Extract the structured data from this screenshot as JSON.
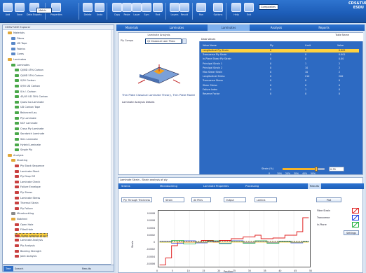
{
  "app": {
    "logo_line1": "CDS&TUDE",
    "logo_line2": "ESDU"
  },
  "toolbar": {
    "items": [
      {
        "label": "Add",
        "icon": "add-document-icon"
      },
      {
        "label": "Save",
        "icon": "save-icon"
      },
      {
        "label": "Data Exports",
        "icon": "export-icon"
      },
      {
        "label": "Properties",
        "icon": "properties-icon"
      },
      {
        "label": "Delete",
        "icon": "delete-icon"
      },
      {
        "label": "Undo",
        "icon": "undo-icon"
      },
      {
        "label": "Copy",
        "icon": "copy-icon"
      },
      {
        "label": "Paste",
        "icon": "paste-icon"
      },
      {
        "label": "Layer",
        "icon": "layer-icon"
      },
      {
        "label": "Sym",
        "icon": "symmetry-icon"
      },
      {
        "label": "Find",
        "icon": "find-icon"
      },
      {
        "label": "Layers",
        "icon": "layers-icon"
      },
      {
        "label": "Result",
        "icon": "result-icon"
      },
      {
        "label": "Run",
        "icon": "run-icon"
      },
      {
        "label": "Options",
        "icon": "options-icon"
      },
      {
        "label": "Help",
        "icon": "help-icon"
      },
      {
        "label": "Exit",
        "icon": "exit-icon"
      }
    ],
    "unit_combo": "Metric",
    "layers_combo": "Composites",
    "composite_label": "Composites"
  },
  "tree": {
    "header": "CDS&TUDE Explorer",
    "rows": [
      {
        "text": "Materials",
        "icon": "fold",
        "indent": 1
      },
      {
        "text": "Fibres",
        "icon": "doc",
        "indent": 2
      },
      {
        "text": "UD Tape",
        "icon": "doc",
        "indent": 2
      },
      {
        "text": "Fabrics",
        "icon": "doc",
        "indent": 2
      },
      {
        "text": "Cores",
        "icon": "doc",
        "indent": 2
      },
      {
        "text": "Laminates",
        "icon": "fold",
        "indent": 1
      },
      {
        "text": "Laminates",
        "icon": "grn",
        "indent": 2
      },
      {
        "text": "QI/ND 45% Carbon",
        "icon": "grn",
        "indent": 3
      },
      {
        "text": "QI/ND 55% Carbon",
        "icon": "grn",
        "indent": 3
      },
      {
        "text": "0/90 Carbon",
        "icon": "grn",
        "indent": 3
      },
      {
        "text": "0/90 UD Carbon",
        "icon": "grn",
        "indent": 3
      },
      {
        "text": "0/+/- Carbon",
        "icon": "grn",
        "indent": 3
      },
      {
        "text": "45/45 UD 30% Carbon",
        "icon": "grn",
        "indent": 3
      },
      {
        "text": "Quasi Iso Laminate",
        "icon": "grn",
        "indent": 3
      },
      {
        "text": "UD Carbon Tape",
        "icon": "grn",
        "indent": 3
      },
      {
        "text": "Balanced Lay",
        "icon": "grn",
        "indent": 3
      },
      {
        "text": "Ply Laminate",
        "icon": "grn",
        "indent": 3
      },
      {
        "text": "NCF Laminate",
        "icon": "grn",
        "indent": 3
      },
      {
        "text": "Cross Ply Laminate",
        "icon": "grn",
        "indent": 3
      },
      {
        "text": "Sandwich Laminate",
        "icon": "grn",
        "indent": 3
      },
      {
        "text": "Skin Laminate",
        "icon": "grn",
        "indent": 3
      },
      {
        "text": "Hybrid Laminate",
        "icon": "grn",
        "indent": 3
      },
      {
        "text": "Single Ply",
        "icon": "grn",
        "indent": 3
      },
      {
        "text": "Analysis",
        "icon": "fold",
        "indent": 1
      },
      {
        "text": "Stacking",
        "icon": "fold",
        "indent": 2
      },
      {
        "text": "Ply Stack Sequence",
        "icon": "red",
        "indent": 3
      },
      {
        "text": "Laminate Stack",
        "icon": "red",
        "indent": 3
      },
      {
        "text": "Ply Drop Off",
        "icon": "red",
        "indent": 3
      },
      {
        "text": "Laminate Check",
        "icon": "red",
        "indent": 3
      },
      {
        "text": "Failure Envelope",
        "icon": "red",
        "indent": 3
      },
      {
        "text": "Ply Stress",
        "icon": "red",
        "indent": 3
      },
      {
        "text": "Laminate Stress",
        "icon": "red",
        "indent": 3
      },
      {
        "text": "Thermal Strain",
        "icon": "red",
        "indent": 3
      },
      {
        "text": "Ply Failure",
        "icon": "red",
        "indent": 3
      },
      {
        "text": "Microbuckling",
        "icon": "tool",
        "indent": 2
      },
      {
        "text": "Notched",
        "icon": "fold",
        "indent": 2
      },
      {
        "text": "Open Hole",
        "icon": "red",
        "indent": 3
      },
      {
        "text": "Filled Hole",
        "icon": "red",
        "indent": 3
      },
      {
        "text": "Strain analysis of ply",
        "icon": "red",
        "indent": 3,
        "selected": true
      },
      {
        "text": "Laminate Analysis",
        "icon": "red",
        "indent": 3
      },
      {
        "text": "Ply Analysis",
        "icon": "red",
        "indent": 3
      },
      {
        "text": "Bearing Strength",
        "icon": "red",
        "indent": 3
      },
      {
        "text": "Joint Analysis",
        "icon": "red",
        "indent": 3
      }
    ]
  },
  "bottom_tabs": [
    {
      "label": "Tree"
    },
    {
      "label": "Search"
    },
    {
      "label": "Results"
    }
  ],
  "main_tabs": [
    {
      "label": "Materials",
      "active": false
    },
    {
      "label": "Laminates",
      "active": false
    },
    {
      "label": "Laminates",
      "active": true
    },
    {
      "label": "Analysis",
      "active": false
    },
    {
      "label": "Reports",
      "active": false
    }
  ],
  "panel": {
    "header": "Laminate Analysis",
    "combo_label": "Ply Compo",
    "combo_value": "QI Classical Lam Theo",
    "title": "Thin Plate Classical Laminate Theory, Thin Plate Model",
    "link": "Laminate Analysis Details",
    "table_title": "Data Values",
    "table_col_title": "Table Name"
  },
  "table": {
    "headers": [
      "Value Name",
      "Ply",
      "Limit",
      "Value"
    ],
    "rows": [
      {
        "name": "Longitudinal Ply Strain",
        "c1": "0",
        "c2": "0",
        "c3": "0.002",
        "hl": true
      },
      {
        "name": "Transverse Ply Strain",
        "c1": "0",
        "c2": "0",
        "c3": "0.001"
      },
      {
        "name": "In-Plane Shear Ply Strain",
        "c1": "0",
        "c2": "0",
        "c3": "0.00"
      },
      {
        "name": "Principal Strain 1",
        "c1": "0",
        "c2": "1",
        "c3": "2"
      },
      {
        "name": "Principal Strain 2",
        "c1": "0",
        "c2": "10",
        "c3": "2"
      },
      {
        "name": "Max Shear Strain",
        "c1": "0",
        "c2": "10",
        "c3": "2"
      },
      {
        "name": "Longitudinal Stress",
        "c1": "0",
        "c2": "210",
        "c3": "200"
      },
      {
        "name": "Transverse Stress",
        "c1": "0",
        "c2": "0",
        "c3": "0"
      },
      {
        "name": "Shear Stress",
        "c1": "0",
        "c2": "0",
        "c3": "0"
      },
      {
        "name": "Failure Index",
        "c1": "0",
        "c2": "1",
        "c3": "0"
      },
      {
        "name": "Reserve Factor",
        "c1": "0",
        "c2": "0",
        "c3": "0"
      }
    ],
    "slider_label": "Strain (%)",
    "slider_value": "0.35",
    "slider_ticks": [
      "0",
      "10%",
      "20%",
      "30%",
      "40%",
      "50%"
    ]
  },
  "lower": {
    "title": "Laminate Strain - Strain analysis of ply",
    "tabs": [
      {
        "label": "Strains",
        "active": false
      },
      {
        "label": "Microbuckling",
        "active": false
      },
      {
        "label": "Laminate Properties",
        "active": false
      },
      {
        "label": "Processing",
        "active": false
      },
      {
        "label": "Results",
        "active": true
      }
    ],
    "controls": [
      {
        "label": "Ply Through Thickness",
        "type": "select"
      },
      {
        "label": "Strain",
        "type": "select"
      },
      {
        "label": "All Plies",
        "type": "select"
      },
      {
        "label": "Output",
        "type": "select"
      },
      {
        "label": "Lamina",
        "type": "select"
      },
      {
        "label": "Plot",
        "type": "button"
      }
    ],
    "legend": [
      {
        "label": "Fibre Strain",
        "color": "#e02020"
      },
      {
        "label": "Transverse",
        "color": "#2040e0"
      },
      {
        "label": "In-Plane",
        "color": "#20b040"
      }
    ],
    "legend_button": "Settings"
  },
  "chart_data": {
    "type": "line",
    "xlabel": "Position",
    "ylabel": "Strain",
    "x_ticks": [
      "0",
      "5",
      "10",
      "15",
      "20",
      "25",
      "30",
      "35",
      "40",
      "45",
      "50"
    ],
    "y_ticks": [
      "0.0008",
      "0.0006",
      "0.0004",
      "0.0002",
      "0",
      "-0.0002",
      "-0.0004",
      "-0.0006"
    ],
    "ylim": [
      -0.0007,
      0.0009
    ],
    "xlim": [
      0,
      50
    ],
    "series": [
      {
        "color": "#e02020",
        "points": [
          [
            0,
            -0.00065
          ],
          [
            2,
            -0.00045
          ],
          [
            4,
            -0.0001
          ],
          [
            6,
            0.0
          ],
          [
            10,
            0.0
          ],
          [
            14,
            5e-05
          ],
          [
            18,
            0.0
          ],
          [
            20,
            5e-05
          ],
          [
            24,
            0.0001
          ],
          [
            28,
            0.00015
          ],
          [
            32,
            0.0002
          ],
          [
            34,
            0.0001
          ],
          [
            38,
            0.00012
          ],
          [
            42,
            0.0002
          ],
          [
            46,
            0.0003
          ],
          [
            48,
            0.0007
          ]
        ]
      },
      {
        "color": "#2040e0",
        "points": [
          [
            0,
            3e-05
          ],
          [
            4,
            -3e-05
          ],
          [
            8,
            4e-05
          ],
          [
            12,
            -2e-05
          ],
          [
            16,
            2e-05
          ],
          [
            20,
            -3e-05
          ],
          [
            24,
            4e-05
          ],
          [
            28,
            -2e-05
          ],
          [
            32,
            3e-05
          ],
          [
            36,
            -2e-05
          ],
          [
            40,
            3e-05
          ],
          [
            44,
            -2e-05
          ],
          [
            48,
            2e-05
          ]
        ]
      },
      {
        "color": "#20b040",
        "points": [
          [
            0,
            0.0
          ],
          [
            4,
            5e-05
          ],
          [
            8,
            -5e-05
          ],
          [
            12,
            0.0
          ],
          [
            16,
            4e-05
          ],
          [
            20,
            -4e-05
          ],
          [
            24,
            3e-05
          ],
          [
            28,
            -3e-05
          ],
          [
            32,
            4e-05
          ],
          [
            36,
            -3e-05
          ],
          [
            40,
            2e-05
          ],
          [
            44,
            0.0
          ],
          [
            48,
            1e-05
          ]
        ]
      },
      {
        "color": "#f0c020",
        "points": [
          [
            0,
            0.0
          ],
          [
            10,
            0.0
          ],
          [
            20,
            0.0
          ],
          [
            30,
            0.0
          ],
          [
            40,
            0.0
          ],
          [
            48,
            0.0
          ]
        ]
      },
      {
        "color": "#303030",
        "points": [
          [
            0,
            3e-05
          ],
          [
            8,
            3e-05
          ],
          [
            16,
            3e-05
          ],
          [
            24,
            3e-05
          ],
          [
            32,
            3e-05
          ],
          [
            40,
            3e-05
          ],
          [
            48,
            3e-05
          ]
        ]
      }
    ]
  }
}
